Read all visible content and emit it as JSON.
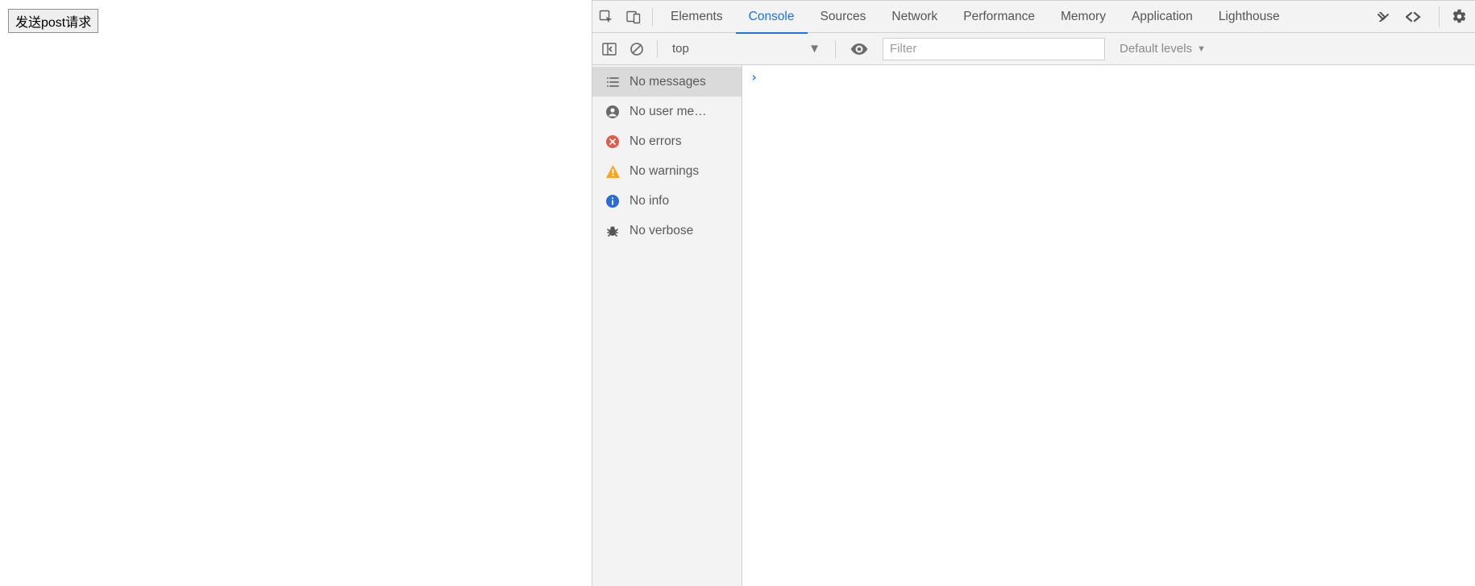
{
  "page": {
    "button_label": "发送post请求"
  },
  "devtools": {
    "tabs": {
      "elements": "Elements",
      "console": "Console",
      "sources": "Sources",
      "network": "Network",
      "performance": "Performance",
      "memory": "Memory",
      "application": "Application",
      "lighthouse": "Lighthouse"
    },
    "active_tab": "console",
    "toolbar": {
      "context": "top",
      "filter_placeholder": "Filter",
      "filter_value": "",
      "levels_label": "Default levels"
    },
    "sidebar": {
      "messages": "No messages",
      "user": "No user me…",
      "errors": "No errors",
      "warnings": "No warnings",
      "info": "No info",
      "verbose": "No verbose"
    },
    "prompt": "›"
  }
}
